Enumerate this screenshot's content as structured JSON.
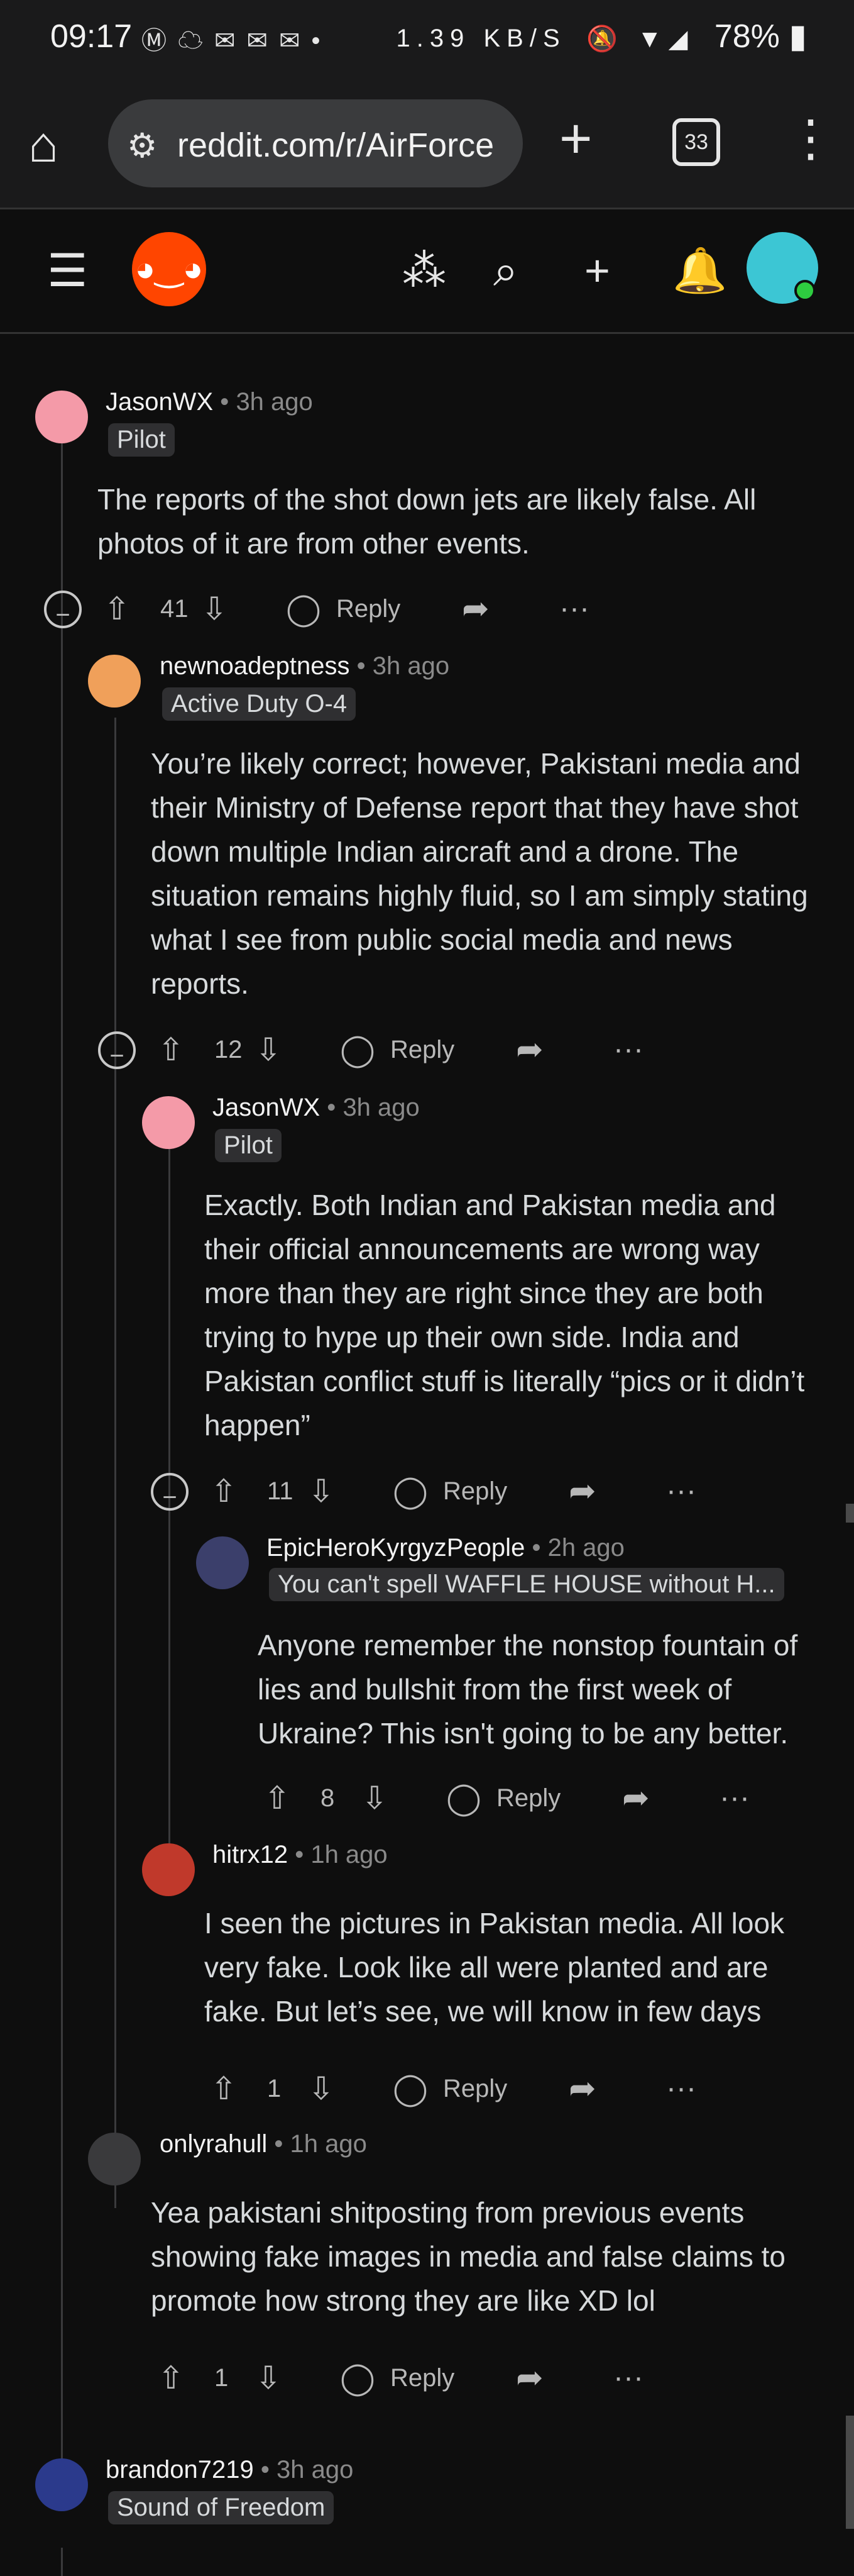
{
  "status_bar": {
    "time": "09:17",
    "network_speed": "1.39 KB/S",
    "battery": "78%"
  },
  "browser": {
    "url": "reddit.com/r/AirForce",
    "tab_count": "33"
  },
  "comments": [
    {
      "user": "JasonWX",
      "time": "3h ago",
      "flair": "Pilot",
      "body": "The reports of the shot down jets are likely false. All photos of it are from other events.",
      "votes": "41",
      "reply": "Reply"
    },
    {
      "user": "newnoadeptness",
      "time": "3h ago",
      "flair": "Active Duty O-4",
      "body": "You’re likely correct; however, Pakistani media and their Ministry of Defense report that they have shot down multiple Indian aircraft and a drone. The situation remains highly fluid, so I am simply stating what I see from public social media and news reports.",
      "votes": "12",
      "reply": "Reply"
    },
    {
      "user": "JasonWX",
      "time": "3h ago",
      "flair": "Pilot",
      "body": "Exactly. Both Indian and Pakistan media and their official announcements are wrong way more than they are right since they are both trying to hype up their own side. India and Pakistan conflict stuff is literally “pics or it didn’t happen”",
      "votes": "11",
      "reply": "Reply"
    },
    {
      "user": "EpicHeroKyrgyzPeople",
      "time": "2h ago",
      "flair": "You can't spell WAFFLE HOUSE without H...",
      "body": "Anyone remember the nonstop fountain of lies and bullshit from the first week of Ukraine? This isn't going to be any better.",
      "votes": "8",
      "reply": "Reply"
    },
    {
      "user": "hitrx12",
      "time": "1h ago",
      "body": "I seen the pictures in Pakistan media. All look very fake. Look like all were planted and are fake. But let’s see, we will know in few days",
      "votes": "1",
      "reply": "Reply"
    },
    {
      "user": "onlyrahull",
      "time": "1h ago",
      "body": "Yea pakistani shitposting from previous events showing fake images in media and false claims to promote how strong they are like XD lol",
      "votes": "1",
      "reply": "Reply"
    },
    {
      "user": "brandon7219",
      "time": "3h ago",
      "flair": "Sound of Freedom"
    }
  ],
  "separator": "•",
  "colors": {
    "background": "#0e0e0e",
    "reddit_orange": "#ff4500",
    "text": "#d7dadc",
    "muted": "#8a8a8a"
  }
}
